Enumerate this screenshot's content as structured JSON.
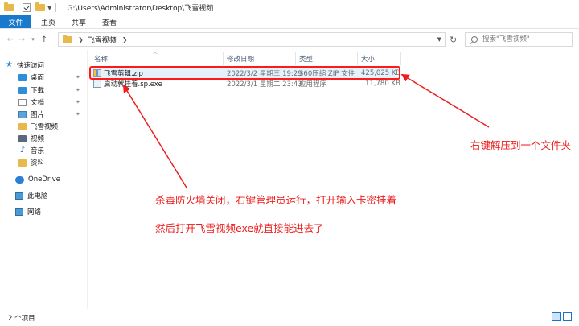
{
  "window": {
    "title_path": "G:\\Users\\Administrator\\Desktop\\飞雪视频"
  },
  "ribbon": {
    "tabs": [
      "文件",
      "主页",
      "共享",
      "查看"
    ]
  },
  "address": {
    "crumb": "飞雪视频",
    "search_placeholder": "搜索\"飞雪视频\""
  },
  "sidebar": {
    "items": [
      {
        "label": "快速访问",
        "icon": "star-icon",
        "pinned": false
      },
      {
        "label": "桌面",
        "icon": "desktop-icon",
        "pinned": true
      },
      {
        "label": "下载",
        "icon": "download-icon",
        "pinned": true
      },
      {
        "label": "文档",
        "icon": "document-icon",
        "pinned": true
      },
      {
        "label": "图片",
        "icon": "picture-icon",
        "pinned": true
      },
      {
        "label": "飞雪视频",
        "icon": "folder-icon",
        "pinned": false
      },
      {
        "label": "视频",
        "icon": "video-icon",
        "pinned": false
      },
      {
        "label": "音乐",
        "icon": "music-icon",
        "pinned": false
      },
      {
        "label": "资料",
        "icon": "folder-icon",
        "pinned": false
      },
      {
        "label": "OneDrive",
        "icon": "cloud-icon",
        "pinned": false
      },
      {
        "label": "此电脑",
        "icon": "pc-icon",
        "pinned": false
      },
      {
        "label": "网络",
        "icon": "network-icon",
        "pinned": false
      }
    ]
  },
  "columns": {
    "name": "名称",
    "modified": "修改日期",
    "type": "类型",
    "size": "大小"
  },
  "files": [
    {
      "name": "飞雪剪辑.zip",
      "modified": "2022/3/2 星期三 19:29",
      "type": "360压缩 ZIP 文件",
      "size": "425,025 KB",
      "icon": "zip-file-icon"
    },
    {
      "name": "启动就挂着.sp.exe",
      "modified": "2022/3/1 星期二 23:43",
      "type": "应用程序",
      "size": "11,780 KB",
      "icon": "exe-file-icon"
    }
  ],
  "annotations": {
    "right": "右键解压到一个文件夹",
    "line1": "杀毒防火墙关闭，右键管理员运行，打开输入卡密挂着",
    "line2": "然后打开飞雪视频exe就直接能进去了"
  },
  "status": {
    "count": "2 个项目"
  },
  "colors": {
    "accent": "#1979ca",
    "annotation": "#ee1c1c",
    "selection": "#e5f1fb"
  }
}
